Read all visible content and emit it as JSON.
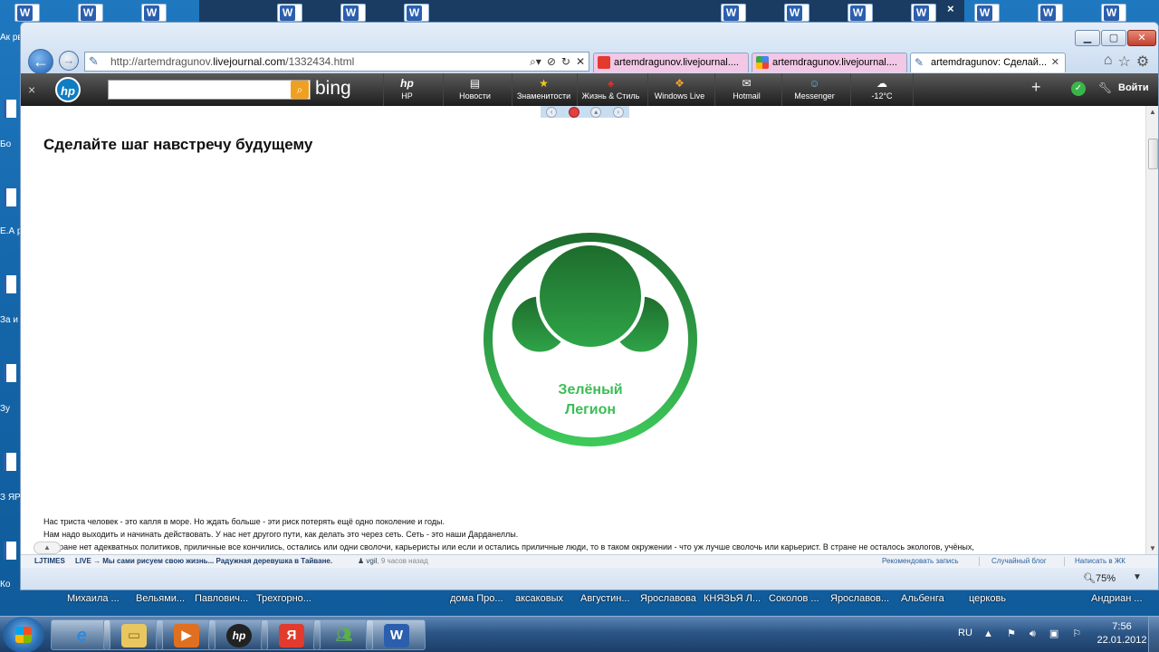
{
  "browser": {
    "url_plain": "http://artemdragunov.",
    "url_domain": "livejournal.com",
    "url_path": "/1332434.html",
    "tabs": [
      {
        "label": "artemdragunov.livejournal....",
        "icon": "yandex-icon",
        "color": "#f2c8e6"
      },
      {
        "label": "artemdragunov.livejournal....",
        "icon": "google-icon",
        "color": "#f2c8e6"
      },
      {
        "label": "artemdragunov: Сделай...",
        "icon": "livejournal-pencil-icon",
        "color": "#ffffff"
      }
    ]
  },
  "toolbar": {
    "bing": "bing",
    "items": [
      {
        "label": "HP",
        "glyph": "hp"
      },
      {
        "label": "Новости",
        "glyph": "▤"
      },
      {
        "label": "Знаменитости",
        "glyph": "★"
      },
      {
        "label": "Жизнь & Стиль",
        "glyph": "♠"
      },
      {
        "label": "Windows Live",
        "glyph": "❖"
      },
      {
        "label": "Hotmail",
        "glyph": "✉"
      },
      {
        "label": "Messenger",
        "glyph": "☺"
      },
      {
        "label": "-12°C",
        "glyph": "☁"
      }
    ],
    "login": "Войти"
  },
  "page": {
    "title": "Сделайте шаг навстречу будущему",
    "logo_line1": "Зелёный",
    "logo_line2": "Легион",
    "paragraphs": [
      "Нас триста человек - это капля в море. Но ждать больше - эти риск потерять ещё одно поколение и годы.",
      "Нам надо выходить и начинать действовать. У нас нет другого пути, как делать это через сеть. Сеть  - это наши Дарданеллы.",
      "В стране нет адекватных политиков, приличные все кончились, остались или одни сволочи, карьеристы или если и остались приличные люди, то в таком окружении - что уж лучше сволочь или карьерист. В стране не осталось экологов, учёных,"
    ]
  },
  "ljbar": {
    "brand": "LJTIMES",
    "live": "LIVE → Мы сами рисуем свою жизнь... Радужная деревушка в Тайване.",
    "user": "vgil",
    "time": ", 9 часов назад",
    "recommend": "Рекомендовать запись",
    "random": "Случайный блог",
    "write": "Написать в ЖК"
  },
  "status": {
    "zoom": "75%"
  },
  "desktop_bottom": [
    "Михаила ...",
    "Вельями...",
    "Павлович...",
    "Трехгорно...",
    "дома Про...",
    "аксаковых",
    "Августин...",
    "Ярославова",
    "КНЯЗЬЯ Л...",
    "Соколов ...",
    "Ярославов...",
    "Альбенга",
    "церковь",
    "Андриан ..."
  ],
  "desktop_left": [
    "Ак рв",
    "Бо",
    "Е.А р",
    "За и",
    "Зу",
    "З ЯР",
    "Ко"
  ],
  "tray": {
    "lang": "RU",
    "time": "7:56",
    "date": "22.01.2012"
  },
  "colors": {
    "logo_dark": "#1e6e30",
    "logo_light": "#3ec95a",
    "logo_text": "#3bbd55"
  }
}
